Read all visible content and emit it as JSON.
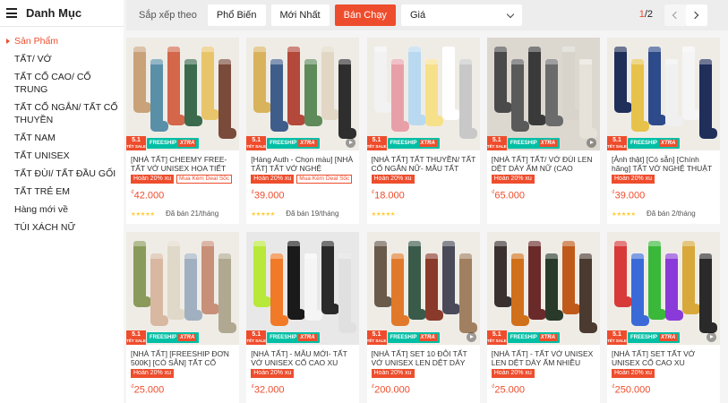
{
  "sidebar": {
    "title": "Danh Mục",
    "items": [
      {
        "label": "Sản Phẩm",
        "active": true
      },
      {
        "label": "TẤT/ VỚ"
      },
      {
        "label": "TẤT CỔ CAO/ CỔ TRUNG"
      },
      {
        "label": "TẤT CỔ NGẮN/ TẤT CỔ THUYỀN"
      },
      {
        "label": "TẤT NAM"
      },
      {
        "label": "TẤT UNISEX"
      },
      {
        "label": "TẤT ĐÙI/ TẤT ĐẦU GỐI"
      },
      {
        "label": "TẤT TRẺ EM"
      },
      {
        "label": "Hàng mới về"
      },
      {
        "label": "TÚI XÁCH NỮ"
      }
    ]
  },
  "sortbar": {
    "label": "Sắp xếp theo",
    "options": [
      "Phổ Biến",
      "Mới Nhất",
      "Bán Chạy"
    ],
    "active": "Bán Chạy",
    "price_select": "Giá",
    "page_current": "1",
    "page_total": "/2"
  },
  "badges": {
    "sale_top": "5.1",
    "sale_bottom": "TẾT SALE",
    "freeship": "FREESHIP",
    "xtra": "XTRA"
  },
  "products": [
    {
      "name": "[NHÀ TẤT] CHEEMY FREE- TẤT VỚ UNISEX HỌA TIẾT TRAN...",
      "tags": [
        "Hoàn 20% xu",
        "Mua Kèm Deal Sốc"
      ],
      "currency": "₫",
      "price": "42.000",
      "rating": "★★★★★",
      "sold": "Đã bán 21/tháng",
      "video": false,
      "colors": [
        "#c9a27a",
        "#5a8fa8",
        "#d4664a",
        "#3b6b4c",
        "#e8c56a",
        "#7a4a3a"
      ]
    },
    {
      "name": "[Hàng Auth - Chọn màu] [NHÀ TẤT] TẤT VỚ NGHỆ THUẬT-...",
      "tags": [
        "Hoàn 20% xu",
        "Mua Kèm Deal Sốc"
      ],
      "currency": "₫",
      "price": "39.000",
      "rating": "★★★★★",
      "sold": "Đã bán 19/tháng",
      "video": true,
      "colors": [
        "#d9b25c",
        "#3f5d8a",
        "#b4483a",
        "#5f8a5a",
        "#e1d7c4",
        "#2e2e2e"
      ]
    },
    {
      "name": "[NHÀ TẤT] TẤT THUYỀN/ TẤT CỔ NGẮN NỮ- MẪU TẤT ƯA...",
      "tags": [
        "Hoàn 20% xu"
      ],
      "currency": "₫",
      "price": "18.000",
      "rating": "★★★★★",
      "sold": "",
      "video": false,
      "colors": [
        "#f2f2f2",
        "#e8a0a8",
        "#b8d9f0",
        "#f7e08a",
        "#ffffff",
        "#c8c8c8"
      ]
    },
    {
      "name": "[NHÀ TẤT] TẤT/ VỚ ĐÙI LEN DỆT DÀY ẤM NỮ (CAO QUA...",
      "tags": [
        "Hoàn 20% xu"
      ],
      "currency": "₫",
      "price": "65.000",
      "rating": "",
      "sold": "",
      "video": true,
      "colors": [
        "#4a4a4a",
        "#5a5a5a",
        "#3a3a3a",
        "#6b6b6b",
        "#d8d4cc",
        "#e6e2da"
      ]
    },
    {
      "name": "[Ảnh thật] [Có sẵn] [Chính hãng] TẤT VỚ NGHỆ THUẬT TIA...",
      "tags": [
        "Hoàn 20% xu"
      ],
      "currency": "₫",
      "price": "39.000",
      "rating": "★★★★★",
      "sold": "Đã bán 2/tháng",
      "video": false,
      "colors": [
        "#1f2f5a",
        "#e6c24a",
        "#2d4a8a",
        "#f0f0f0",
        "#f5f5f5",
        "#1f2f5a"
      ]
    },
    {
      "name": "[NHÀ TẤT] [FREESHIP ĐƠN 500K] [CÓ SẴN] TẤT CỔ CAO...",
      "tags": [
        "Hoàn 20% xu"
      ],
      "currency": "₫",
      "price": "25.000",
      "rating": "",
      "sold": "",
      "video": false,
      "colors": [
        "#8a9a5a",
        "#d8b8a0",
        "#e0d8c8",
        "#a0b0c0",
        "#c89078",
        "#b0a890"
      ]
    },
    {
      "name": "[NHÀ TẤT] - MẪU MỚI- TẤT VỚ UNISEX CỔ CAO XU HƯỚNG...",
      "tags": [
        "Hoàn 20% xu"
      ],
      "currency": "₫",
      "price": "32.000",
      "rating": "",
      "sold": "",
      "video": false,
      "colors": [
        "#b8e83a",
        "#f07a28",
        "#1a1a1a",
        "#f5f5f5",
        "#2a2a2a",
        "#e0e0e0"
      ]
    },
    {
      "name": "[NHÀ TẤT] SET 10 ĐÔI TẤT VỚ UNISEX LEN DỆT DÀY ẤM...",
      "tags": [
        "Hoàn 20% xu"
      ],
      "currency": "₫",
      "price": "200.000",
      "rating": "",
      "sold": "",
      "video": true,
      "colors": [
        "#6a5a4a",
        "#e07a2a",
        "#3a5a4a",
        "#8a3a2a",
        "#4a4a5a",
        "#a08060"
      ]
    },
    {
      "name": "[NHÀ TẤT] - TẤT VỚ UNISEX LEN DỆT DÀY ẤM NHIỀU MÀ...",
      "tags": [
        "Hoàn 20% xu"
      ],
      "currency": "₫",
      "price": "25.000",
      "rating": "",
      "sold": "",
      "video": false,
      "colors": [
        "#3a3030",
        "#d0701a",
        "#6a2a2a",
        "#2a3a2a",
        "#c05a1a",
        "#4a3a30"
      ]
    },
    {
      "name": "[NHÀ TẤT] SET TẤT VỚ UNISEX CỔ CAO XU HƯỚNG - CARO...",
      "tags": [
        "Hoàn 20% xu"
      ],
      "currency": "₫",
      "price": "250.000",
      "rating": "",
      "sold": "",
      "video": true,
      "colors": [
        "#d83a3a",
        "#3a6ad8",
        "#3ab83a",
        "#8a3ad8",
        "#d8a83a",
        "#2a2a2a"
      ]
    }
  ]
}
